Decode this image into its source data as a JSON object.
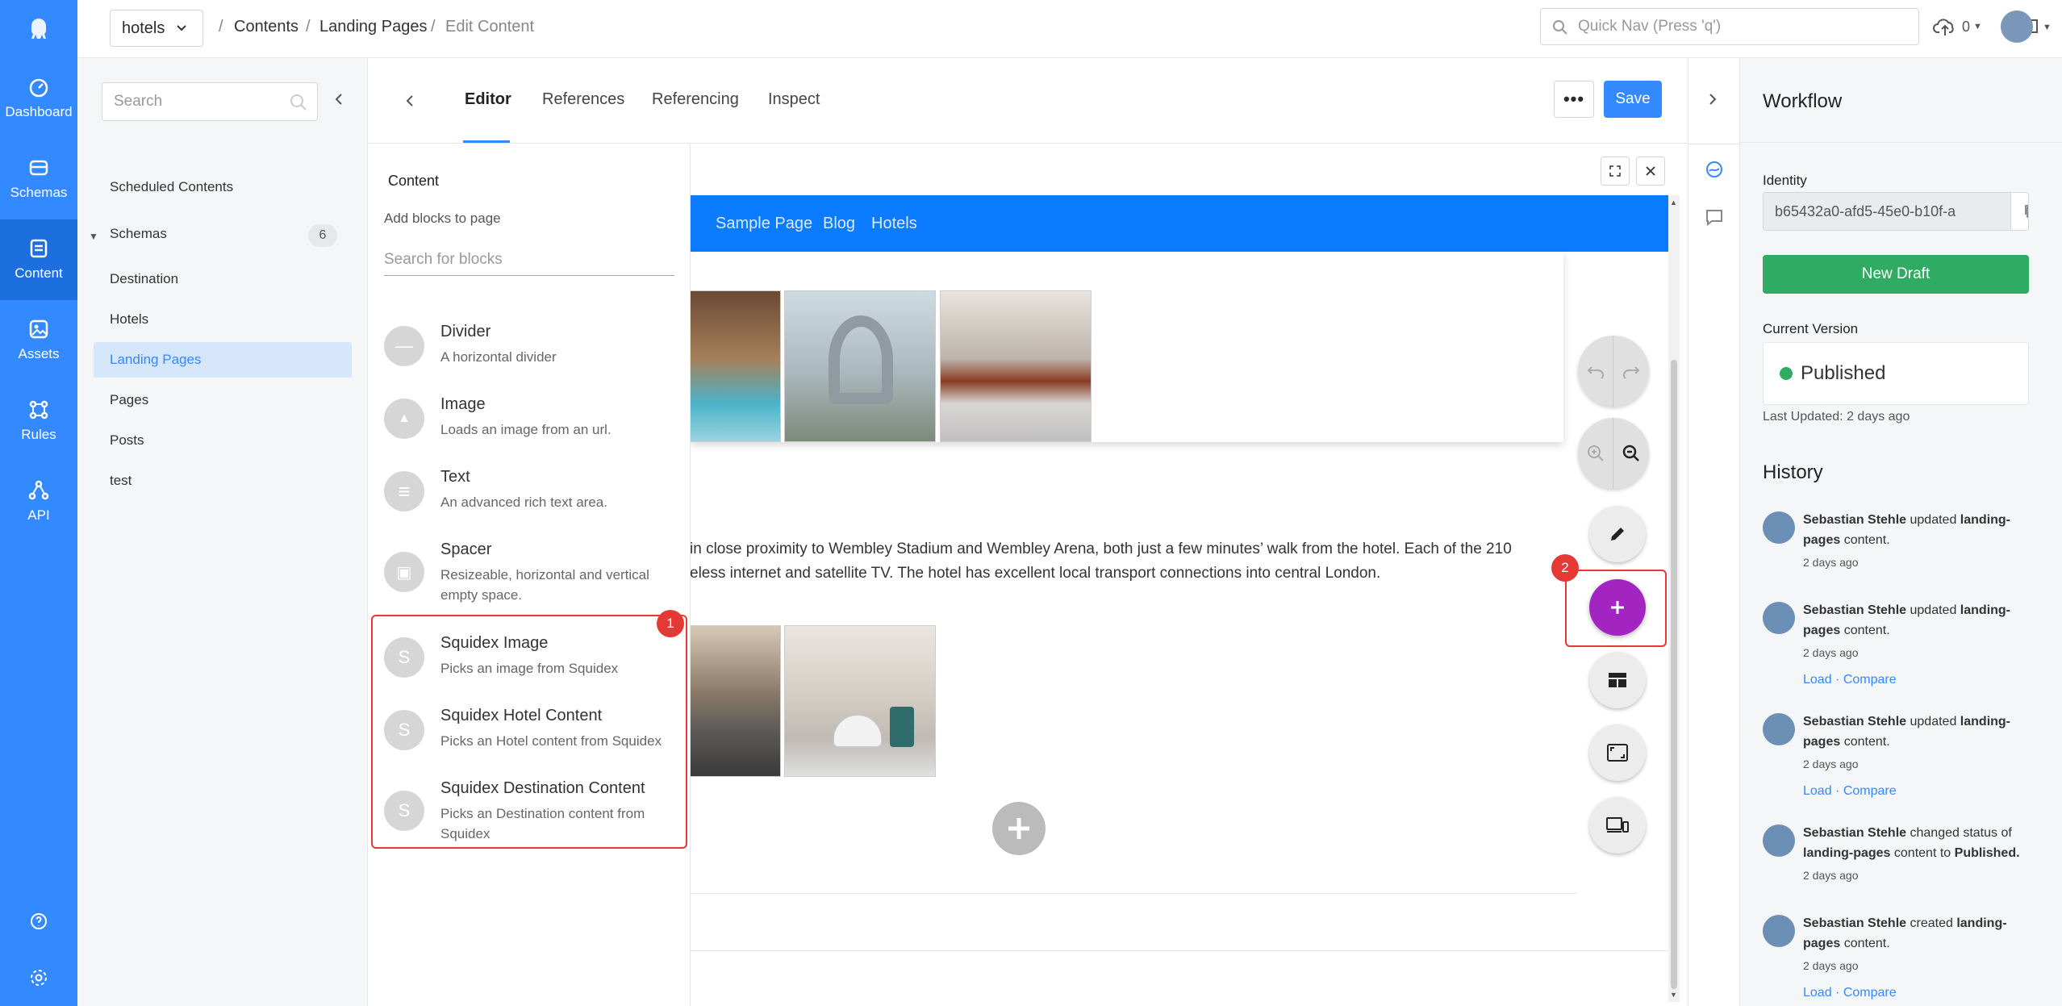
{
  "sidebar": {
    "items": [
      {
        "label": "Dashboard",
        "icon": "dashboard-icon"
      },
      {
        "label": "Schemas",
        "icon": "schemas-icon"
      },
      {
        "label": "Content",
        "icon": "content-icon"
      },
      {
        "label": "Assets",
        "icon": "assets-icon"
      },
      {
        "label": "Rules",
        "icon": "rules-icon"
      },
      {
        "label": "API",
        "icon": "api-icon"
      }
    ]
  },
  "topbar": {
    "app": "hotels",
    "breadcrumb": [
      "Contents",
      "Landing Pages",
      "Edit Content"
    ],
    "quicknav_placeholder": "Quick Nav (Press 'q')",
    "upload_count": "0"
  },
  "schemas_panel": {
    "search_placeholder": "Search",
    "scheduled": "Scheduled Contents",
    "section": "Schemas",
    "count": "6",
    "items": [
      "Destination",
      "Hotels",
      "Landing Pages",
      "Pages",
      "Posts",
      "test"
    ]
  },
  "editor": {
    "tabs": [
      "Editor",
      "References",
      "Referencing",
      "Inspect"
    ],
    "more_label": "•••",
    "save_label": "Save"
  },
  "blocks": {
    "heading": "Content",
    "subheading": "Add blocks to page",
    "search_placeholder": "Search for blocks",
    "items": [
      {
        "title": "Divider",
        "desc": "A horizontal divider",
        "icon": "—"
      },
      {
        "title": "Image",
        "desc": "Loads an image from an url.",
        "icon": "▲"
      },
      {
        "title": "Text",
        "desc": "An advanced rich text area.",
        "icon": "≡"
      },
      {
        "title": "Spacer",
        "desc": "Resizeable, horizontal and vertical empty space.",
        "icon": "▣"
      },
      {
        "title": "Squidex Image",
        "desc": "Picks an image from Squidex",
        "icon": "S"
      },
      {
        "title": "Squidex Hotel Content",
        "desc": "Picks an Hotel content from Squidex",
        "icon": "S"
      },
      {
        "title": "Squidex Destination Content",
        "desc": "Picks an Destination content from Squidex",
        "icon": "S"
      }
    ]
  },
  "canvas": {
    "nav": [
      "Sample Page",
      "Blog",
      "Hotels"
    ],
    "text_line1": "in close proximity to Wembley Stadium and Wembley Arena, both just a few minutes’ walk from the hotel. Each of the 210",
    "text_line2": "eless internet and satellite TV. The hotel has excellent local transport connections into central London.",
    "badge1": "1",
    "badge2": "2"
  },
  "workflow": {
    "title": "Workflow",
    "identity_label": "Identity",
    "identity_value": "b65432a0-afd5-45e0-b10f-a",
    "new_draft": "New Draft",
    "current_version_label": "Current Version",
    "status": "Published",
    "last_updated": "Last Updated: 2 days ago",
    "history_title": "History",
    "history": [
      {
        "user": "Sebastian Stehle",
        "action": "updated",
        "object": "landing-pages",
        "suffix": "content.",
        "time": "2 days ago",
        "links": false
      },
      {
        "user": "Sebastian Stehle",
        "action": "updated",
        "object": "landing-pages",
        "suffix": "content.",
        "time": "2 days ago",
        "links": true
      },
      {
        "user": "Sebastian Stehle",
        "action": "updated",
        "object": "landing-pages",
        "suffix": "content.",
        "time": "2 days ago",
        "links": true
      },
      {
        "user": "Sebastian Stehle",
        "action": "changed status of",
        "object": "landing-pages",
        "suffix": "content to",
        "status": "Published.",
        "time": "2 days ago",
        "links": false
      },
      {
        "user": "Sebastian Stehle",
        "action": "created",
        "object": "landing-pages",
        "suffix": "content.",
        "time": "2 days ago",
        "links": true
      }
    ],
    "load_label": "Load",
    "compare_label": "Compare"
  },
  "colors": {
    "accent": "#3389ff",
    "success": "#2fab63",
    "add_button": "#a225c2",
    "highlight": "#e53935"
  }
}
